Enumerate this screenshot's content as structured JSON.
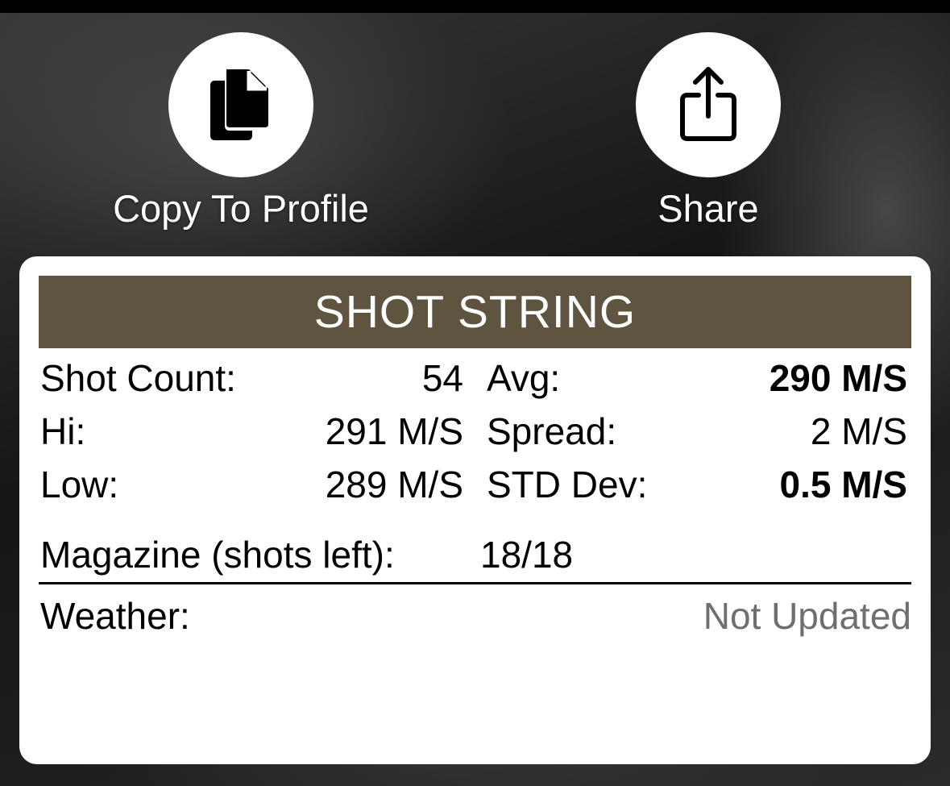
{
  "actions": {
    "copy_label": "Copy To Profile",
    "share_label": "Share"
  },
  "icons": {
    "copy": "copy-documents-icon",
    "share": "share-icon"
  },
  "shot_string": {
    "title": "SHOT STRING",
    "header_color": "#5e5440",
    "shot_count_label": "Shot Count:",
    "shot_count_value": "54",
    "avg_label": "Avg:",
    "avg_value": "290 M/S",
    "hi_label": "Hi:",
    "hi_value": "291 M/S",
    "spread_label": "Spread:",
    "spread_value": "2 M/S",
    "low_label": "Low:",
    "low_value": "289 M/S",
    "std_dev_label": "STD Dev:",
    "std_dev_value": "0.5 M/S",
    "magazine_label": "Magazine (shots left):",
    "magazine_value": "18/18",
    "weather_label": "Weather:",
    "weather_value": "Not Updated"
  }
}
